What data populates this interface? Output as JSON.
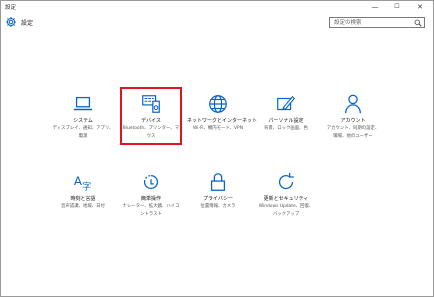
{
  "window": {
    "title": "設定",
    "min_glyph": "—",
    "max_glyph": "☐",
    "close_glyph": "✕"
  },
  "header": {
    "title": "設定",
    "icon": "gear-icon"
  },
  "search": {
    "placeholder": "設定の検索",
    "icon": "search-icon"
  },
  "tiles": [
    {
      "icon": "system-laptop-icon",
      "label": "システム",
      "desc": [
        "ディスプレイ、通知、アプリ、",
        "電源"
      ]
    },
    {
      "icon": "devices-icon",
      "label": "デバイス",
      "desc": [
        "Bluetooth、プリンター、マ",
        "ウス"
      ]
    },
    {
      "icon": "network-globe-icon",
      "label": "ネットワークとインターネット",
      "desc": [
        "Wi-Fi、機内モード、VPN"
      ]
    },
    {
      "icon": "personalization-brush-icon",
      "label": "パーソナル設定",
      "desc": [
        "背景、ロック画面、色"
      ]
    },
    {
      "icon": "accounts-person-icon",
      "label": "アカウント",
      "desc": [
        "アカウント、同期の設定、",
        "職場、他のユーザー"
      ]
    },
    {
      "icon": "time-language-icon",
      "label": "時刻と言語",
      "desc": [
        "音声認識、地域、日付"
      ]
    },
    {
      "icon": "ease-of-access-icon",
      "label": "簡単操作",
      "desc": [
        "ナレーター、拡大鏡、ハイコ",
        "ントラスト"
      ]
    },
    {
      "icon": "privacy-lock-icon",
      "label": "プライバシー",
      "desc": [
        "位置情報、カメラ"
      ]
    },
    {
      "icon": "update-security-icon",
      "label": "更新とセキュリティ",
      "desc": [
        "Windows Update、回復、",
        "バックアップ"
      ]
    }
  ],
  "highlight": {
    "target": "デバイス",
    "color": "#e0141e"
  },
  "accent_color": "#0a64c8"
}
